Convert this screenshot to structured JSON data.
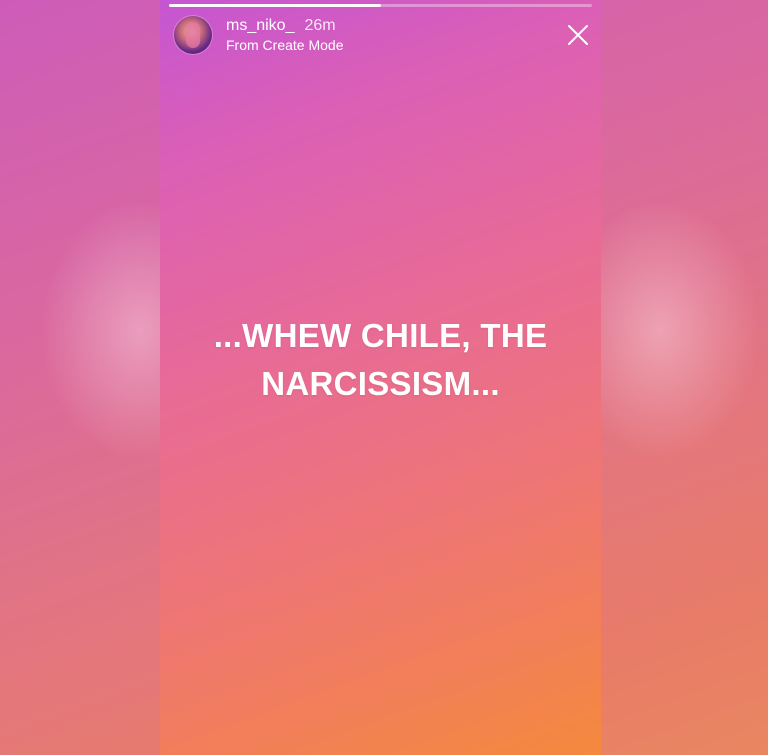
{
  "story": {
    "progress": 0.5,
    "user": {
      "username": "ms_niko_",
      "time_ago": "26m",
      "subtitle": "From Create Mode"
    },
    "text_line1": "...WHEW CHILE, THE",
    "text_line2": "NARCISSISM...",
    "colors": {
      "gradient_top": "#c555d2",
      "gradient_mid": "#ee7479",
      "gradient_bottom": "#f5893d",
      "text": "#ffffff"
    },
    "icons": {
      "close": "close-icon",
      "avatar": "avatar"
    }
  }
}
